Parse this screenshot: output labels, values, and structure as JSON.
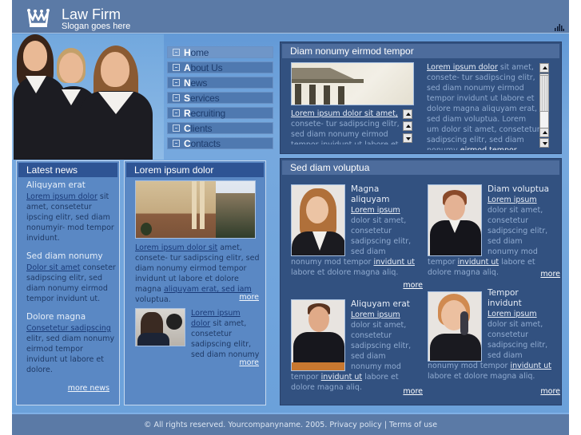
{
  "header": {
    "title": "Law Firm",
    "slogan": "Slogan goes here"
  },
  "nav": {
    "items": [
      {
        "label": "Home",
        "active": true
      },
      {
        "label": "About Us"
      },
      {
        "label": "News"
      },
      {
        "label": "Services"
      },
      {
        "label": "Recruiting"
      },
      {
        "label": "Clients"
      },
      {
        "label": "Contacts"
      }
    ]
  },
  "featured": {
    "heading": "Diam nonumy eirmod tempor",
    "left": {
      "link": "Lorem ipsum dolor sit amet,",
      "text": "consete- tur sadipscing elitr, sed diam nonumy eirmod tempor invidunt ut labore et"
    },
    "right": {
      "link": "Lorem ipsum dolor",
      "text": " sit amet, consete- tur sadipscing elitr, sed diam nonumy eirmod tempor invidunt ut labore et dolore magna aliquyam erat, sed diam voluptua. Lorem um dolor sit amet, consetetur sadipscing elitr, sed diam nonumy ",
      "tail_link": "eirmod tempor vidunt"
    }
  },
  "latest_news": {
    "heading": "Latest news",
    "items": [
      {
        "title": "Aliquyam erat",
        "link": "Lorem ipsum dolor",
        "text": " sit amet, consetetur ipscing elitr, sed diam nonumyir- mod tempor invidunt."
      },
      {
        "title": "Sed diam nonumy",
        "link": "Dolor sit amet",
        "text": " conseter sadipscing elitr, sed diam nonumy eirmod tempor invidunt ut."
      },
      {
        "title": "Dolore magna",
        "link": "Consetetur sadipscing",
        "text": " elitr, sed diam nonumy eirmod tempor invidunt ut labore et dolore."
      }
    ],
    "more": "more news"
  },
  "lorem_panel": {
    "heading": "Lorem ipsum dolor",
    "article1": {
      "link1": "Lorem ipsum dolor sit",
      "text1": " amet, consete- tur sadipscing elitr, sed diam nonumy eirmod tempor invidunt ut labore et dolore magna ",
      "link2": "aliquyam erat, sed iam",
      "text2": " voluptua.",
      "more": "more"
    },
    "article2": {
      "link": "Lorem ipsum dolor",
      "text": " sit amet, consetetur sadipscing elitr, sed diam nonumy",
      "more": "more"
    }
  },
  "team": {
    "heading": "Sed diam voluptua",
    "members": [
      {
        "name": "Magna aliquyam",
        "link": "Lorem ipsum",
        "text": " dolor sit amet, consetetur sadipscing elitr, sed diam nonumy mod tempor ",
        "link2": "invidunt ut",
        "text2": " labore et dolore magna aliq.",
        "more": "more"
      },
      {
        "name": "Diam voluptua",
        "link": "Lorem ipsum",
        "text": " dolor sit amet, consetetur sadipscing elitr, sed diam nonumy mod tempor ",
        "link2": "invidunt ut",
        "text2": " labore et dolore magna aliq.",
        "more": "more"
      },
      {
        "name": "Aliquyam erat",
        "link": "Lorem ipsum",
        "text": " dolor sit amet, consetetur sadipscing elitr, sed diam nonumy mod tempor ",
        "link2": "invidunt ut",
        "text2": " labore et dolore magna aliq.",
        "more": "more"
      },
      {
        "name": "Tempor invidunt",
        "link": "Lorem ipsum",
        "text": " dolor sit amet, consetetur sadipscing elitr, sed diam nonumy mod tempor ",
        "link2": "invidunt ut",
        "text2": " labore et dolore magna aliq.",
        "more": "more"
      }
    ]
  },
  "footer": {
    "copyright": "© All rights reserved. Yourcompanyname. 2005.",
    "privacy": "Privacy policy",
    "separator": "|",
    "terms": "Terms of use"
  },
  "icons": {
    "logo": "crown-icon",
    "stats": "bar-chart-icon",
    "nav_bullet": "plus-box-icon",
    "scroll_up": "arrow-up-icon",
    "scroll_down": "arrow-down-icon"
  },
  "colors": {
    "header_bg": "#5b7aa6",
    "page_bg": "#6aa0da",
    "dark_panel": "#325180",
    "light_panel": "#5a88c4",
    "nav_item": "#4f79b0"
  }
}
